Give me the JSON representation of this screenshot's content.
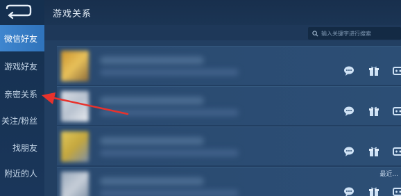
{
  "header": {
    "title": "游戏关系"
  },
  "sidebar": {
    "items": [
      {
        "label": "微信好友",
        "active": true
      },
      {
        "label": "游戏好友",
        "active": false
      },
      {
        "label": "亲密关系",
        "active": false
      },
      {
        "label": "关注/粉丝",
        "active": false
      },
      {
        "label": "找朋友",
        "active": false
      },
      {
        "label": "附近的人",
        "active": false
      }
    ]
  },
  "search": {
    "placeholder": "输入关键字进行搜索"
  },
  "friends": {
    "rows": [
      {
        "time": ""
      },
      {
        "time": ""
      },
      {
        "time": ""
      },
      {
        "time": "最近..."
      }
    ],
    "actions": [
      "chat-bubble-icon",
      "gift-icon",
      "team-invite-icon"
    ]
  },
  "colors": {
    "background": "#1e3859",
    "sidebar": "#15304f",
    "active_tab": "#3f86cf",
    "row": "#2a4a70",
    "action_icon": "#cfe2f5",
    "annotation_arrow": "#e8322c"
  }
}
